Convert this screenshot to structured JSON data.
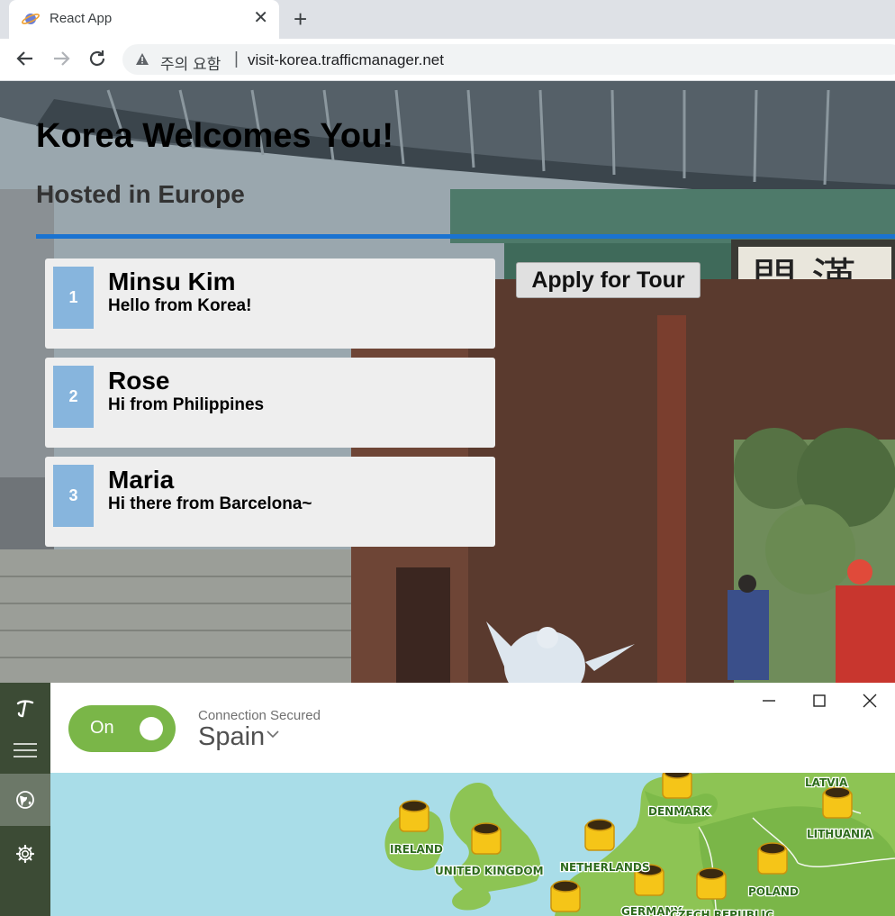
{
  "browser": {
    "tab_title": "React App",
    "tab_close": "✕",
    "new_tab": "+",
    "security_warning": "주의 요함",
    "url_separator": "|",
    "url": "visit-korea.trafficmanager.net"
  },
  "page": {
    "title": "Korea Welcomes You!",
    "subtitle": "Hosted in Europe",
    "apply_button": "Apply for Tour",
    "visitors": [
      {
        "number": "1",
        "name": "Minsu Kim",
        "message": "Hello from Korea!"
      },
      {
        "number": "2",
        "name": "Rose",
        "message": "Hi from Philippines"
      },
      {
        "number": "3",
        "name": "Maria",
        "message": "Hi there from Barcelona~"
      }
    ]
  },
  "vpn": {
    "toggle_label": "On",
    "status": "Connection Secured",
    "country": "Spain",
    "accent_color": "#7ab648",
    "sidebar_color": "#3c4b35",
    "map_labels": {
      "ireland": "IRELAND",
      "uk": "UNITED KINGDOM",
      "netherlands": "NETHERLANDS",
      "denmark": "DENMARK",
      "latvia": "LATVIA",
      "lithuania": "LITHUANIA",
      "poland": "POLAND",
      "germany": "GERMANY",
      "czech": "CZECH REPUBLIC"
    }
  }
}
